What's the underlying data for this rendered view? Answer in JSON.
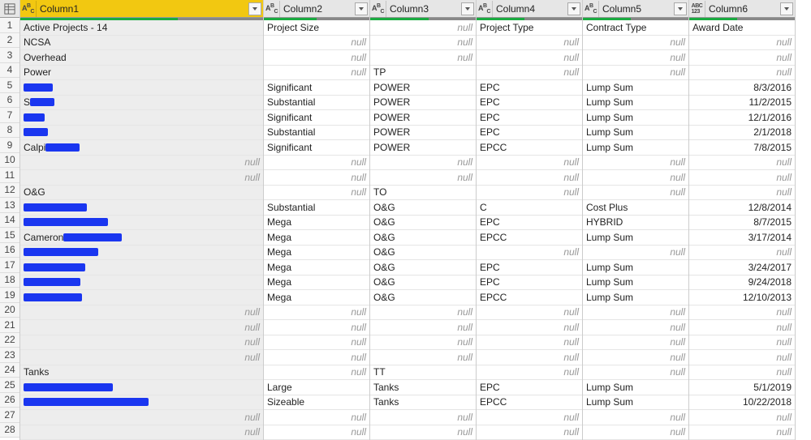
{
  "null_text": "null",
  "columns": [
    {
      "key": "Column1",
      "label": "Column1",
      "type": "ABC",
      "selected": true,
      "quality": {
        "valid": 65,
        "empty": 35
      }
    },
    {
      "key": "Column2",
      "label": "Column2",
      "type": "ABC",
      "selected": false,
      "quality": {
        "valid": 50,
        "empty": 50
      }
    },
    {
      "key": "Column3",
      "label": "Column3",
      "type": "ABC",
      "selected": false,
      "quality": {
        "valid": 55,
        "empty": 45
      }
    },
    {
      "key": "Column4",
      "label": "Column4",
      "type": "ABC",
      "selected": false,
      "quality": {
        "valid": 45,
        "empty": 55
      }
    },
    {
      "key": "Column5",
      "label": "Column5",
      "type": "ABC",
      "selected": false,
      "quality": {
        "valid": 45,
        "empty": 55
      }
    },
    {
      "key": "Column6",
      "label": "Column6",
      "type": "ABC123",
      "selected": false,
      "quality": {
        "valid": 45,
        "empty": 55
      }
    }
  ],
  "rows": [
    {
      "n": 1,
      "grey": true,
      "c1": {
        "text": "Active Projects - 14"
      },
      "c2": {
        "text": "Project Size"
      },
      "c3": {
        "null": true
      },
      "c4": {
        "text": "Project Type"
      },
      "c5": {
        "text": "Contract Type"
      },
      "c6": {
        "text": "Award Date",
        "align": "left"
      }
    },
    {
      "n": 2,
      "grey": true,
      "c1": {
        "text": "NCSA"
      },
      "c2": {
        "null": true
      },
      "c3": {
        "null": true
      },
      "c4": {
        "null": true
      },
      "c5": {
        "null": true
      },
      "c6": {
        "null": true
      }
    },
    {
      "n": 3,
      "grey": true,
      "c1": {
        "text": "Overhead"
      },
      "c2": {
        "null": true
      },
      "c3": {
        "null": true
      },
      "c4": {
        "null": true
      },
      "c5": {
        "null": true
      },
      "c6": {
        "null": true
      }
    },
    {
      "n": 4,
      "grey": true,
      "c1": {
        "text": "Power"
      },
      "c2": {
        "null": true
      },
      "c3": {
        "text": "TP"
      },
      "c4": {
        "null": true
      },
      "c5": {
        "null": true
      },
      "c6": {
        "null": true
      }
    },
    {
      "n": 5,
      "grey": true,
      "c1": {
        "redact": "r1"
      },
      "c2": {
        "text": "Significant"
      },
      "c3": {
        "text": "POWER"
      },
      "c4": {
        "text": "EPC"
      },
      "c5": {
        "text": "Lump Sum"
      },
      "c6": {
        "text": "8/3/2016",
        "align": "right"
      }
    },
    {
      "n": 6,
      "grey": true,
      "c1": {
        "prefix": "S",
        "redact": "r2"
      },
      "c2": {
        "text": "Substantial"
      },
      "c3": {
        "text": "POWER"
      },
      "c4": {
        "text": "EPC"
      },
      "c5": {
        "text": "Lump Sum"
      },
      "c6": {
        "text": "11/2/2015",
        "align": "right"
      }
    },
    {
      "n": 7,
      "grey": true,
      "c1": {
        "redact": "r3"
      },
      "c2": {
        "text": "Significant"
      },
      "c3": {
        "text": "POWER"
      },
      "c4": {
        "text": "EPC"
      },
      "c5": {
        "text": "Lump Sum"
      },
      "c6": {
        "text": "12/1/2016",
        "align": "right"
      }
    },
    {
      "n": 8,
      "grey": true,
      "c1": {
        "redact": "r4"
      },
      "c2": {
        "text": "Substantial"
      },
      "c3": {
        "text": "POWER"
      },
      "c4": {
        "text": "EPC"
      },
      "c5": {
        "text": "Lump Sum"
      },
      "c6": {
        "text": "2/1/2018",
        "align": "right"
      }
    },
    {
      "n": 9,
      "grey": true,
      "c1": {
        "prefix": "Calpi",
        "redact": "r5"
      },
      "c2": {
        "text": "Significant"
      },
      "c3": {
        "text": "POWER"
      },
      "c4": {
        "text": "EPCC"
      },
      "c5": {
        "text": "Lump Sum"
      },
      "c6": {
        "text": "7/8/2015",
        "align": "right"
      }
    },
    {
      "n": 10,
      "grey": true,
      "c1": {
        "null": true
      },
      "c2": {
        "null": true
      },
      "c3": {
        "null": true
      },
      "c4": {
        "null": true
      },
      "c5": {
        "null": true
      },
      "c6": {
        "null": true
      }
    },
    {
      "n": 11,
      "grey": true,
      "c1": {
        "null": true
      },
      "c2": {
        "null": true
      },
      "c3": {
        "null": true
      },
      "c4": {
        "null": true
      },
      "c5": {
        "null": true
      },
      "c6": {
        "null": true
      }
    },
    {
      "n": 12,
      "grey": true,
      "c1": {
        "text": "O&G"
      },
      "c2": {
        "null": true
      },
      "c3": {
        "text": "TO"
      },
      "c4": {
        "null": true
      },
      "c5": {
        "null": true
      },
      "c6": {
        "null": true
      }
    },
    {
      "n": 13,
      "grey": true,
      "c1": {
        "redact": "r6"
      },
      "c2": {
        "text": "Substantial"
      },
      "c3": {
        "text": "O&G"
      },
      "c4": {
        "text": "C"
      },
      "c5": {
        "text": "Cost Plus"
      },
      "c6": {
        "text": "12/8/2014",
        "align": "right"
      }
    },
    {
      "n": 14,
      "grey": true,
      "c1": {
        "redact": "r7"
      },
      "c2": {
        "text": "Mega"
      },
      "c3": {
        "text": "O&G"
      },
      "c4": {
        "text": "EPC"
      },
      "c5": {
        "text": "HYBRID"
      },
      "c6": {
        "text": "8/7/2015",
        "align": "right"
      }
    },
    {
      "n": 15,
      "grey": true,
      "c1": {
        "prefix": "Cameron ",
        "redact": "r8"
      },
      "c2": {
        "text": "Mega"
      },
      "c3": {
        "text": "O&G"
      },
      "c4": {
        "text": "EPCC"
      },
      "c5": {
        "text": "Lump Sum"
      },
      "c6": {
        "text": "3/17/2014",
        "align": "right"
      }
    },
    {
      "n": 16,
      "grey": true,
      "c1": {
        "redact": "r9"
      },
      "c2": {
        "text": "Mega"
      },
      "c3": {
        "text": "O&G"
      },
      "c4": {
        "null": true
      },
      "c5": {
        "null": true
      },
      "c6": {
        "null": true
      }
    },
    {
      "n": 17,
      "grey": true,
      "c1": {
        "redact": "r10"
      },
      "c2": {
        "text": "Mega"
      },
      "c3": {
        "text": "O&G"
      },
      "c4": {
        "text": "EPC"
      },
      "c5": {
        "text": "Lump Sum"
      },
      "c6": {
        "text": "3/24/2017",
        "align": "right"
      }
    },
    {
      "n": 18,
      "grey": true,
      "c1": {
        "redact": "r11"
      },
      "c2": {
        "text": "Mega"
      },
      "c3": {
        "text": "O&G"
      },
      "c4": {
        "text": "EPC"
      },
      "c5": {
        "text": "Lump Sum"
      },
      "c6": {
        "text": "9/24/2018",
        "align": "right"
      }
    },
    {
      "n": 19,
      "grey": true,
      "c1": {
        "redact": "r12"
      },
      "c2": {
        "text": "Mega"
      },
      "c3": {
        "text": "O&G"
      },
      "c4": {
        "text": "EPCC"
      },
      "c5": {
        "text": "Lump Sum"
      },
      "c6": {
        "text": "12/10/2013",
        "align": "right"
      }
    },
    {
      "n": 20,
      "grey": true,
      "c1": {
        "null": true
      },
      "c2": {
        "null": true
      },
      "c3": {
        "null": true
      },
      "c4": {
        "null": true
      },
      "c5": {
        "null": true
      },
      "c6": {
        "null": true
      }
    },
    {
      "n": 21,
      "grey": true,
      "c1": {
        "null": true
      },
      "c2": {
        "null": true
      },
      "c3": {
        "null": true
      },
      "c4": {
        "null": true
      },
      "c5": {
        "null": true
      },
      "c6": {
        "null": true
      }
    },
    {
      "n": 22,
      "grey": true,
      "c1": {
        "null": true
      },
      "c2": {
        "null": true
      },
      "c3": {
        "null": true
      },
      "c4": {
        "null": true
      },
      "c5": {
        "null": true
      },
      "c6": {
        "null": true
      }
    },
    {
      "n": 23,
      "grey": true,
      "c1": {
        "null": true
      },
      "c2": {
        "null": true
      },
      "c3": {
        "null": true
      },
      "c4": {
        "null": true
      },
      "c5": {
        "null": true
      },
      "c6": {
        "null": true
      }
    },
    {
      "n": 24,
      "grey": true,
      "c1": {
        "text": "Tanks"
      },
      "c2": {
        "null": true
      },
      "c3": {
        "text": "TT"
      },
      "c4": {
        "null": true
      },
      "c5": {
        "null": true
      },
      "c6": {
        "null": true
      }
    },
    {
      "n": 25,
      "grey": true,
      "c1": {
        "redact": "r13"
      },
      "c2": {
        "text": "Large"
      },
      "c3": {
        "text": "Tanks"
      },
      "c4": {
        "text": "EPC"
      },
      "c5": {
        "text": "Lump Sum"
      },
      "c6": {
        "text": "5/1/2019",
        "align": "right"
      }
    },
    {
      "n": 26,
      "grey": true,
      "c1": {
        "redact": "r14"
      },
      "c2": {
        "text": "Sizeable"
      },
      "c3": {
        "text": "Tanks"
      },
      "c4": {
        "text": "EPCC"
      },
      "c5": {
        "text": "Lump Sum"
      },
      "c6": {
        "text": "10/22/2018",
        "align": "right"
      }
    },
    {
      "n": 27,
      "grey": true,
      "c1": {
        "null": true
      },
      "c2": {
        "null": true
      },
      "c3": {
        "null": true
      },
      "c4": {
        "null": true
      },
      "c5": {
        "null": true
      },
      "c6": {
        "null": true
      }
    },
    {
      "n": 28,
      "grey": true,
      "c1": {
        "null": true
      },
      "c2": {
        "null": true
      },
      "c3": {
        "null": true
      },
      "c4": {
        "null": true
      },
      "c5": {
        "null": true
      },
      "c6": {
        "null": true
      }
    }
  ]
}
